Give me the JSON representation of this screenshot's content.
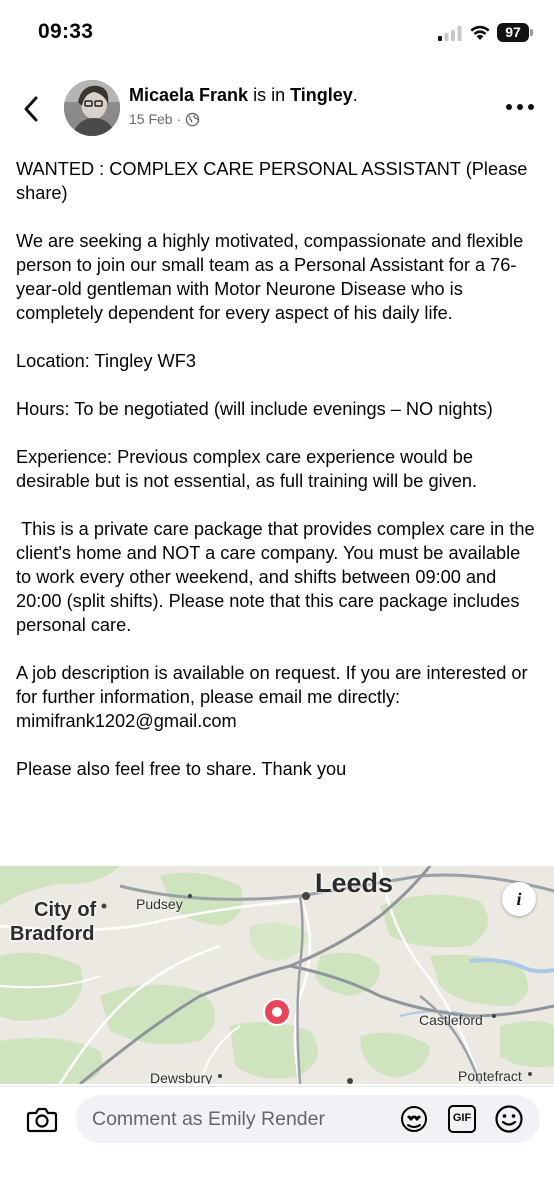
{
  "status_bar": {
    "time": "09:33",
    "battery": "97",
    "icons": [
      "signal-icon",
      "wifi-icon",
      "battery-icon"
    ]
  },
  "header": {
    "author_name": "Micaela Frank",
    "is_in_text": " is in ",
    "location": "Tingley",
    "period": ".",
    "date": "15 Feb",
    "separator": "·",
    "privacy_icon": "globe-icon"
  },
  "post": {
    "paragraphs": [
      "WANTED : COMPLEX CARE PERSONAL ASSISTANT (Please share)",
      "We are seeking a highly motivated, compassionate and flexible person to join our small team as a Personal Assistant for a 76-year-old gentleman with Motor Neurone Disease who is completely dependent for every aspect of his daily life.",
      "Location: Tingley WF3",
      "Hours: To be negotiated (will include evenings – NO nights)",
      "Experience: Previous complex care experience would be desirable but is not essential, as full training will be given.",
      " This is a private care package that provides complex care in the client's home and NOT a care company. You must be available to work every other weekend, and shifts between 09:00 and 20:00 (split shifts). Please note that this care package includes personal care.",
      "A job description is available on request. If you are interested or for further information, please email me directly: mimifrank1202@gmail.com",
      "Please also feel free to share. Thank you"
    ]
  },
  "map": {
    "labels": {
      "city_of": "City of",
      "bradford": "Bradford",
      "leeds": "Leeds",
      "pudsey": "Pudsey",
      "castleford": "Castleford",
      "dewsbury": "Dewsbury",
      "pontefract": "Pontefract"
    },
    "info_label": "i",
    "pin_color": "#e8455a"
  },
  "comment_bar": {
    "placeholder": "Comment as Emily Render",
    "gif_label": "GIF",
    "icons": [
      "camera-icon",
      "avatar-sticker-icon",
      "gif-icon",
      "emoji-icon"
    ]
  }
}
